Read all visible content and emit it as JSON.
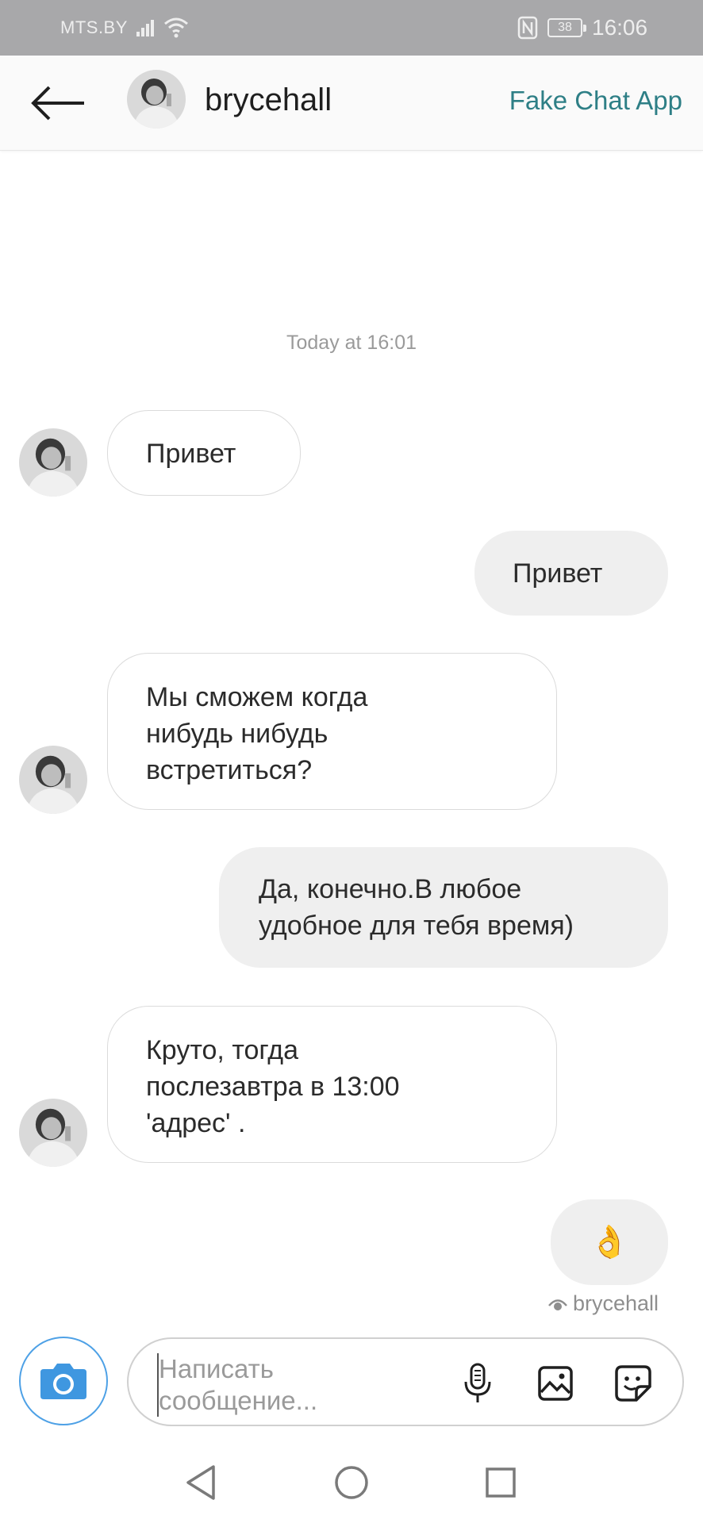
{
  "status_bar": {
    "carrier": "MTS.BY",
    "battery": "38",
    "time": "16:06"
  },
  "header": {
    "username": "brycehall",
    "app_name": "Fake Chat App"
  },
  "chat": {
    "timestamp": "Today at 16:01",
    "messages": [
      {
        "direction": "incoming",
        "text": "Привет"
      },
      {
        "direction": "outgoing",
        "text": "Привет"
      },
      {
        "direction": "incoming",
        "text": "Мы сможем когда\nнибудь нибудь\nвстретиться?"
      },
      {
        "direction": "outgoing",
        "text": "Да, конечно.В любое\nудобное для тебя время)"
      },
      {
        "direction": "incoming",
        "text": "Круто, тогда\nпослезавтра в 13:00\n'адрес' ."
      },
      {
        "direction": "outgoing",
        "text": "👌"
      }
    ],
    "seen_by": "brycehall"
  },
  "composer": {
    "placeholder": "Написать\nсообщение..."
  },
  "icons": {
    "back": "arrow-left-icon",
    "camera": "camera-icon",
    "mic": "microphone-icon",
    "gallery": "image-icon",
    "sticker": "sticker-icon",
    "seen": "eye-icon"
  },
  "colors": {
    "accent_link": "#2e7f86",
    "camera_blue": "#3f97e0",
    "outgoing_bubble": "#efefef",
    "incoming_border": "#dbdbdb"
  }
}
